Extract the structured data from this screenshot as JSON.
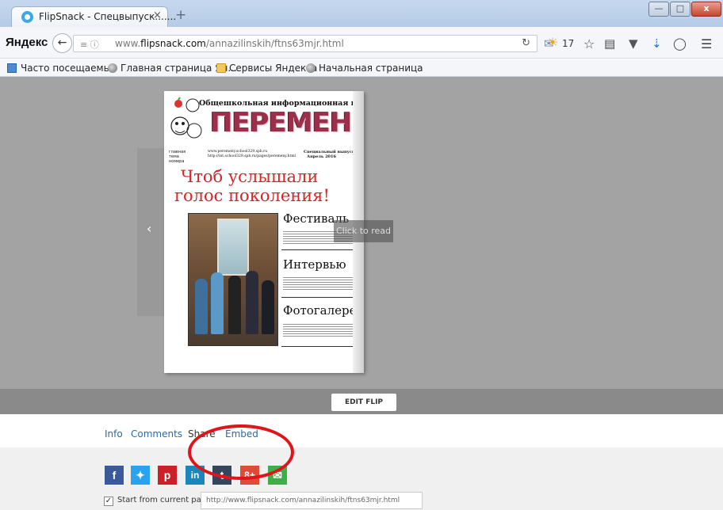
{
  "browser": {
    "tab_title": "FlipSnack - Спецвыпуск.......",
    "tab_close": "×",
    "new_tab": "+",
    "window_controls": {
      "minimize": "—",
      "maximize": "□",
      "close": "x"
    },
    "logo": "Яндекс",
    "url_ident": "≡ ⓘ",
    "url_prefix": "www.",
    "url_domain": "flipsnack.com",
    "url_path": "/annazilinskih/ftns63mjr.html",
    "weather_value": "17",
    "icons": [
      "back-icon",
      "reload-icon",
      "mail-icon",
      "weather-sun-icon",
      "star-icon",
      "reading-list-icon",
      "pocket-icon",
      "download-icon",
      "chat-icon",
      "menu-icon"
    ]
  },
  "bookmarks": [
    {
      "label": "Часто посещаемые",
      "icon": "image-icon"
    },
    {
      "label": "Главная страница Ян...",
      "icon": "globe-icon"
    },
    {
      "label": "Сервисы Яндекса",
      "icon": "folder-icon"
    },
    {
      "label": "Начальная страница",
      "icon": "globe-icon"
    }
  ],
  "newspaper": {
    "header": "Общешкольная информационная газета",
    "masthead": "ПЕРЕМЕНЫ",
    "main_theme": "главная тема номера",
    "site1": "www.peremeny.school329.spb.ru",
    "site2": "http://int.school329.spb.ru/pages/peremeny.html",
    "issue": "Специальный выпуск",
    "date": "Апрель 2016",
    "headline_line1": "Чтоб услышали",
    "headline_line2": "голос поколения!",
    "sections": [
      "Фестиваль",
      "Интервью",
      "Фотогалерея"
    ]
  },
  "viewer": {
    "click_to_read": "Click to read",
    "edit_flip": "EDIT FLIP",
    "prev": "‹"
  },
  "links": {
    "info": "Info",
    "comments": "Comments",
    "share": "Share",
    "embed": "Embed"
  },
  "social": [
    {
      "name": "facebook",
      "glyph": "f",
      "color": "#3b5998"
    },
    {
      "name": "twitter",
      "glyph": "t",
      "color": "#2aa3ef"
    },
    {
      "name": "pinterest",
      "glyph": "p",
      "color": "#cb2027"
    },
    {
      "name": "linkedin",
      "glyph": "in",
      "color": "#1b86bc"
    },
    {
      "name": "tumblr",
      "glyph": "t",
      "color": "#35465c"
    },
    {
      "name": "google-plus",
      "glyph": "8+",
      "color": "#dd4b39"
    },
    {
      "name": "email",
      "glyph": "✉",
      "color": "#3fae49"
    }
  ],
  "share_options": {
    "start_from_current_label": "Start from current page",
    "start_from_current_checked": true,
    "share_url": "http://www.flipsnack.com/annazilinskih/ftns63mjr.html"
  },
  "colors": {
    "annotation_circle": "#e0141a",
    "link": "#2a6aa8",
    "headline": "#d8232a"
  }
}
